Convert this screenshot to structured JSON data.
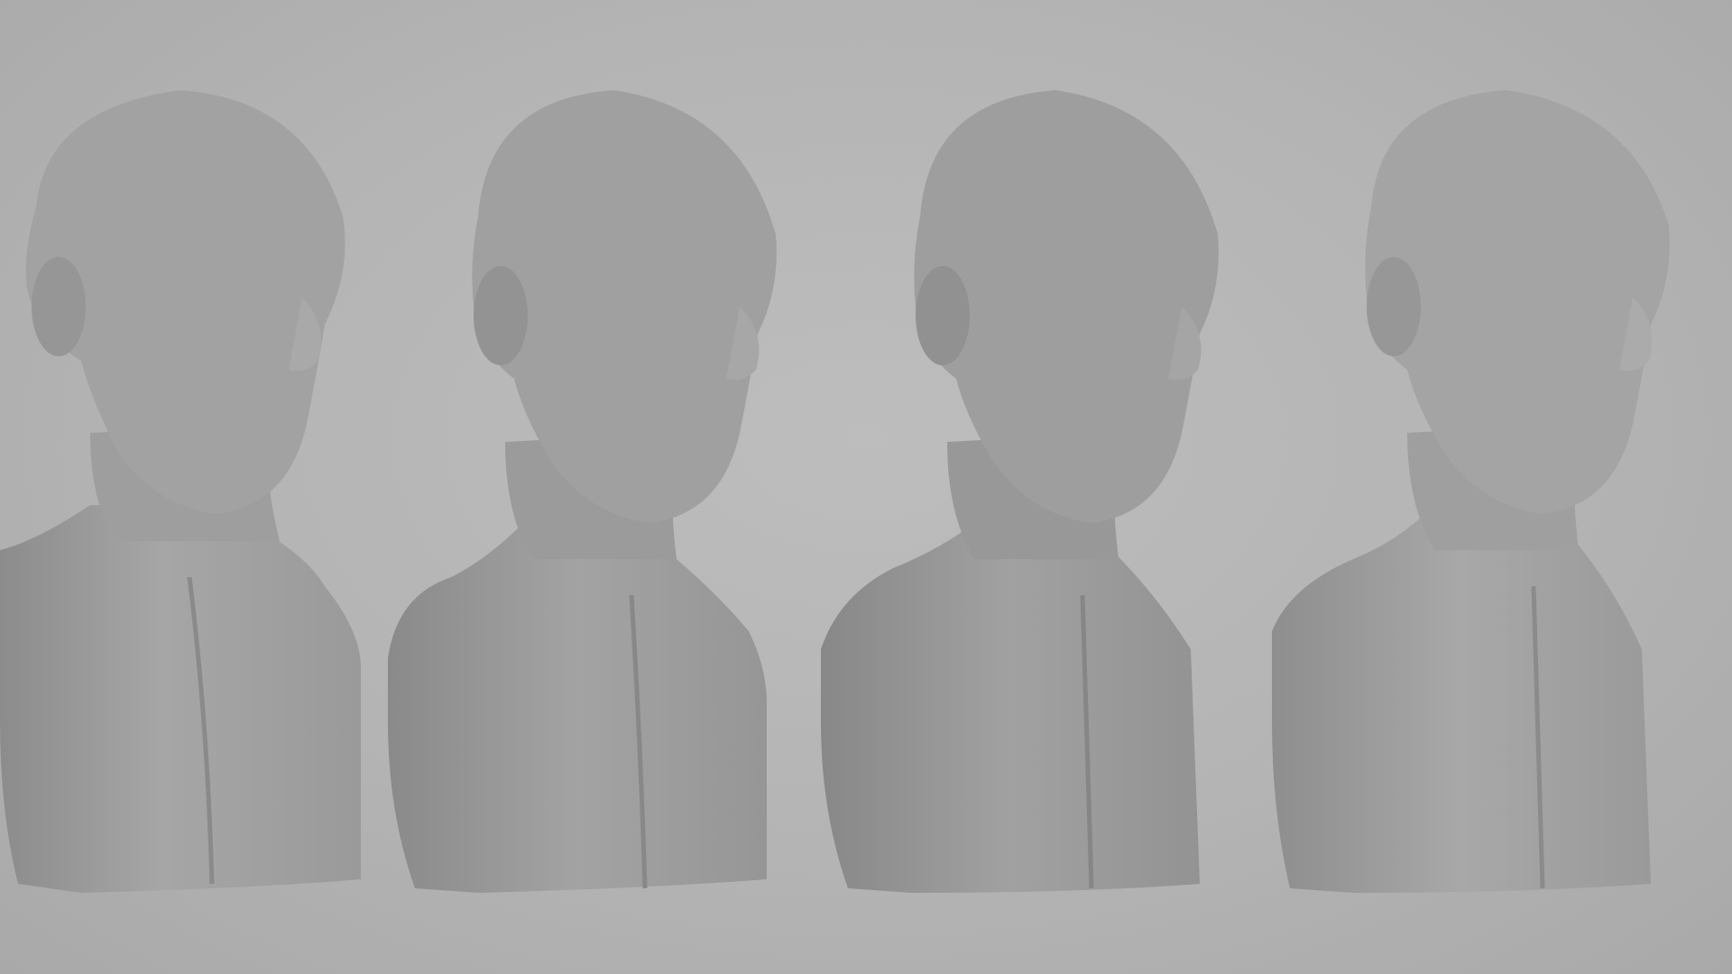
{
  "scene": {
    "description_visible_text": "",
    "background_color": "#b5b5b5",
    "busts": [
      {
        "name": "bust-1",
        "fill": "#9a9a9a"
      },
      {
        "name": "bust-2",
        "fill": "#979797"
      },
      {
        "name": "bust-3",
        "fill": "#959595"
      },
      {
        "name": "bust-4",
        "fill": "#9c9c9c"
      }
    ]
  }
}
